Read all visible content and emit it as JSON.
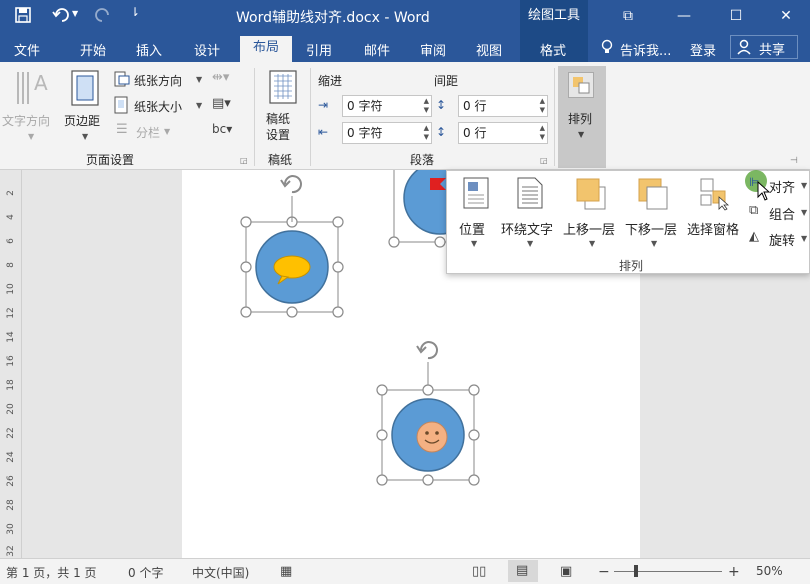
{
  "window": {
    "title": "Word辅助线对齐.docx - Word",
    "context_tool": "绘图工具",
    "min_glyph": "—",
    "max_glyph": "☐",
    "close_glyph": "✕",
    "restore_glyph": "⧉"
  },
  "tabs": [
    "文件",
    "开始",
    "插入",
    "设计",
    "布局",
    "引用",
    "邮件",
    "审阅",
    "视图",
    "格式"
  ],
  "tell_me": "告诉我...",
  "login": "登录",
  "share": "共享",
  "ribbon": {
    "text_direction": "文字方向",
    "margins": "页边距",
    "orientation": "纸张方向",
    "size": "纸张大小",
    "columns": "分栏",
    "page_setup_group": "页面设置",
    "draft_line1": "稿纸",
    "draft_line2": "设置",
    "draft_group": "稿纸",
    "indent_title": "缩进",
    "spacing_title": "间距",
    "indent_left": "0 字符",
    "indent_right": "0 字符",
    "spacing_before": "0 行",
    "spacing_after": "0 行",
    "paragraph_group": "段落",
    "arrange": "排列"
  },
  "arrange_panel": {
    "position": "位置",
    "wrap_text": "环绕文字",
    "bring_forward": "上移一层",
    "send_backward": "下移一层",
    "selection_pane": "选择窗格",
    "align": "对齐",
    "group": "组合",
    "rotate": "旋转",
    "group_label": "排列"
  },
  "ruler_numbers": [
    "2",
    "4",
    "6",
    "8",
    "10",
    "12",
    "14",
    "16",
    "18",
    "20",
    "22",
    "24",
    "26",
    "28",
    "30",
    "32"
  ],
  "status": {
    "page": "第 1 页，共 1 页",
    "words": "0 个字",
    "language": "中文(中国)",
    "zoom": "50%"
  },
  "colors": {
    "brand": "#2b579a",
    "circle_fill": "#5b9bd5",
    "bubble_fill": "#ffc000",
    "face_fill": "#f4b183",
    "sticky_fill": "#f2c46d"
  }
}
